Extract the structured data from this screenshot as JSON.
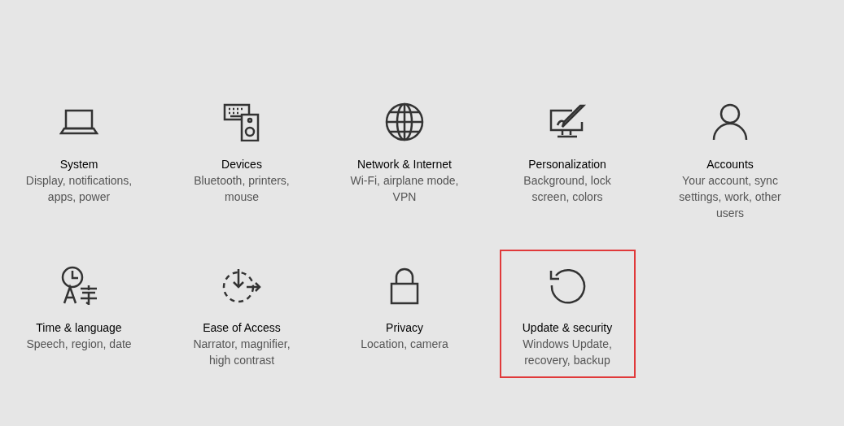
{
  "categories": [
    {
      "kind": "laptop",
      "title": "System",
      "description": "Display, notifications, apps, power",
      "highlighted": false
    },
    {
      "kind": "devices",
      "title": "Devices",
      "description": "Bluetooth, printers, mouse",
      "highlighted": false
    },
    {
      "kind": "globe",
      "title": "Network & Internet",
      "description": "Wi-Fi, airplane mode, VPN",
      "highlighted": false
    },
    {
      "kind": "paint",
      "title": "Personalization",
      "description": "Background, lock screen, colors",
      "highlighted": false
    },
    {
      "kind": "person",
      "title": "Accounts",
      "description": "Your account, sync settings, work, other users",
      "highlighted": false
    },
    {
      "kind": "language",
      "title": "Time & language",
      "description": "Speech, region, date",
      "highlighted": false
    },
    {
      "kind": "ease",
      "title": "Ease of Access",
      "description": "Narrator, magnifier, high contrast",
      "highlighted": false
    },
    {
      "kind": "lock",
      "title": "Privacy",
      "description": "Location, camera",
      "highlighted": false
    },
    {
      "kind": "update",
      "title": "Update & security",
      "description": "Windows Update, recovery, backup",
      "highlighted": true
    }
  ]
}
